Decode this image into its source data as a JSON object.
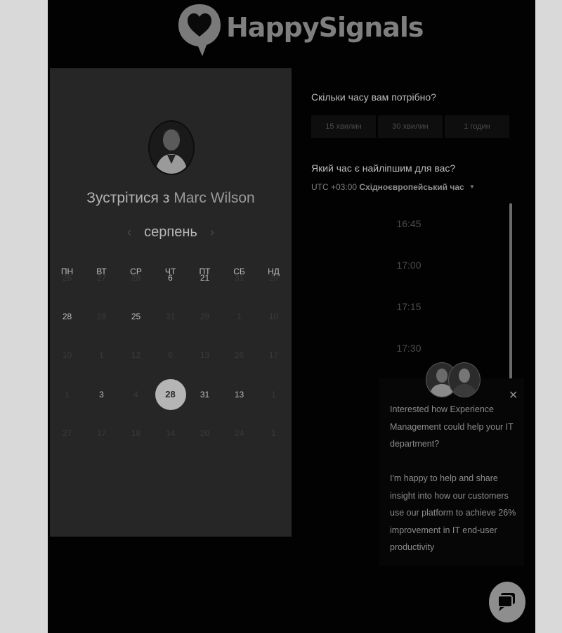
{
  "brand": {
    "name": "HappySignals",
    "icon": "heart-speech-bubble-icon"
  },
  "calendar_panel": {
    "title_prefix": "Зустрітися з",
    "host_name": "Marc Wilson",
    "month": "серпень",
    "weekdays": [
      "ПН",
      "ВТ",
      "СР",
      "ЧТ",
      "ПТ",
      "СБ",
      "НД"
    ],
    "weeks": [
      [
        {
          "d": "26",
          "on": false
        },
        {
          "d": "27",
          "on": false
        },
        {
          "d": "28",
          "on": false
        },
        {
          "d": "6",
          "on": true
        },
        {
          "d": "21",
          "on": true
        },
        {
          "d": "31",
          "on": false
        },
        {
          "d": "29",
          "on": false
        }
      ],
      [
        {
          "d": "28",
          "on": true
        },
        {
          "d": "29",
          "on": false
        },
        {
          "d": "25",
          "on": true
        },
        {
          "d": "31",
          "on": false
        },
        {
          "d": "29",
          "on": false
        },
        {
          "d": "1",
          "on": false
        },
        {
          "d": "10",
          "on": false
        }
      ],
      [
        {
          "d": "10",
          "on": false
        },
        {
          "d": "1",
          "on": false
        },
        {
          "d": "12",
          "on": false
        },
        {
          "d": "6",
          "on": false
        },
        {
          "d": "13",
          "on": false
        },
        {
          "d": "26",
          "on": false
        },
        {
          "d": "17",
          "on": false
        }
      ],
      [
        {
          "d": "1",
          "on": false
        },
        {
          "d": "3",
          "on": true
        },
        {
          "d": "4",
          "on": false
        },
        {
          "d": "28",
          "on": true,
          "sel": true
        },
        {
          "d": "31",
          "on": true
        },
        {
          "d": "13",
          "on": true
        },
        {
          "d": "1",
          "on": false
        }
      ],
      [
        {
          "d": "27",
          "on": false
        },
        {
          "d": "17",
          "on": false
        },
        {
          "d": "18",
          "on": false
        },
        {
          "d": "14",
          "on": false
        },
        {
          "d": "20",
          "on": false
        },
        {
          "d": "24",
          "on": false
        },
        {
          "d": "1",
          "on": false
        }
      ]
    ]
  },
  "booking": {
    "duration_question": "Скільки часу вам потрібно?",
    "durations": [
      "15 хвилин",
      "30 хвилин",
      "1 годин"
    ],
    "time_question": "Який час є найліпшим для вас?",
    "timezone_offset": "UTC +03:00",
    "timezone_name": "Східноєвропейський час",
    "time_slots": [
      "16:45",
      "17:00",
      "17:15",
      "17:30"
    ]
  },
  "chat": {
    "message_1": "Interested how Experience Management could help your IT department?",
    "message_2": "I'm happy to help and share insight into how our customers use our platform to achieve 26% improvement in IT end-user productivity",
    "close_icon": "close-icon",
    "launcher_icon": "chat-bubbles-icon"
  }
}
